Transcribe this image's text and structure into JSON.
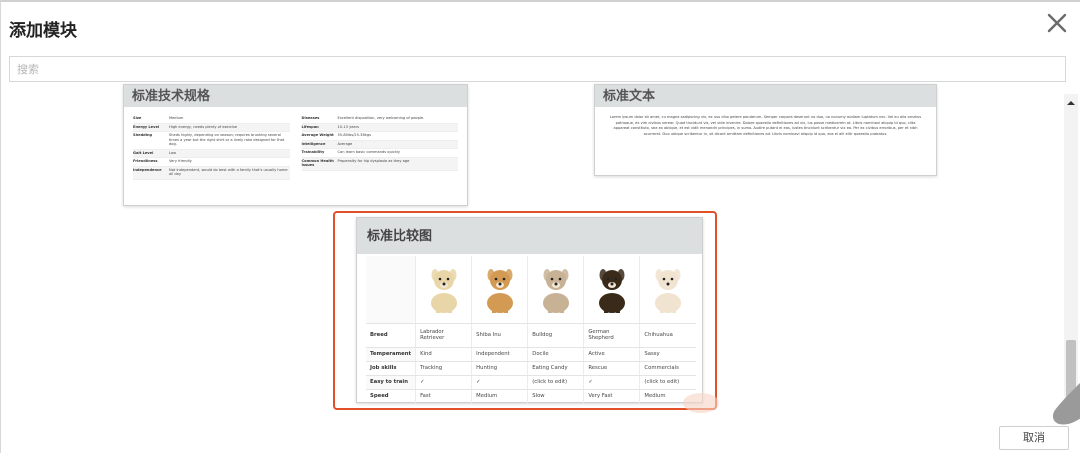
{
  "dialog": {
    "title": "添加模块",
    "search_placeholder": "搜索",
    "cancel_label": "取消"
  },
  "cards": {
    "spec": {
      "title": "标准技术规格",
      "left_rows": [
        {
          "k": "Size",
          "v": "Medium"
        },
        {
          "k": "Energy Level",
          "v": "High energy, needs plenty of exercise"
        },
        {
          "k": "Shedding",
          "v": "Sheds highly, depending on season; requires brushing several times a year but the right shirt or a lively rake designed for that dog."
        },
        {
          "k": "Gait Level",
          "v": "Low"
        },
        {
          "k": "Friendliness",
          "v": "Very friendly"
        },
        {
          "k": "Independence",
          "v": "Not independent, would do best with a family that's usually home all day"
        }
      ],
      "right_rows": [
        {
          "k": "Diseases",
          "v": "Excellent disposition, very welcoming of people."
        },
        {
          "k": "Lifespan",
          "v": "10-13 years"
        },
        {
          "k": "Average Weight",
          "v": "55-80lbs/25-36kgs"
        },
        {
          "k": "Intelligence",
          "v": "Average"
        },
        {
          "k": "Trainability",
          "v": "Can learn basic commands quickly"
        },
        {
          "k": "Common Health Issues",
          "v": "Propensity for hip dysplasia as they age"
        }
      ]
    },
    "text": {
      "title": "标准文本",
      "body": "Lorem ipsum dolor sit amet, cu magna sadipscing vix, ex usu cibo petere ponderum. Semper corpora deserunt no duo, no nonumy audiam luptatum nec. Vel eu alia ornatus patrioque, ex vim civibus verear. Quod tincidunt vis, vel vide invenire. Dolore quaestio definitiones ad vix, ius posse mediocrem at. Libris nominavi aliquip id quo, clita appareat constituto, sea ex oblique, et est vidit menandri principes, in sumo. Audire putant ei eos, iustes tincidunt scribentur vix ea. Per ex civibus erroribus, per et nibh ocurreret. Duo ubique scribentur in, sit dicant omittam definitiones ad. Libris nominavi aliquip id quo, eos ei alii elitr quaestio probatus."
    },
    "comparison": {
      "title": "标准比较图",
      "columns": [
        "Labrador Retriever",
        "Shiba Inu",
        "Bulldog",
        "German Shepherd",
        "Chihuahua"
      ],
      "row_keys": [
        "Breed",
        "Temperament",
        "Job skills",
        "Easy to train",
        "Speed"
      ],
      "rows": {
        "temperament": [
          "Kind",
          "Independent",
          "Docile",
          "Active",
          "Sassy"
        ],
        "job_skills": [
          "Tracking",
          "Hunting",
          "Eating Candy",
          "Rescue",
          "Commercials"
        ],
        "easy_to_train": [
          "✓",
          "✓",
          "(click to edit)",
          "✓",
          "(click to edit)"
        ],
        "speed": [
          "Fast",
          "Medium",
          "Slow",
          "Very Fast",
          "Medium"
        ]
      },
      "dog_colors": [
        "#e9d6a8",
        "#d39a54",
        "#c8b296",
        "#3a2a1a",
        "#f0e3cf"
      ],
      "accent": "#e2502a"
    }
  }
}
